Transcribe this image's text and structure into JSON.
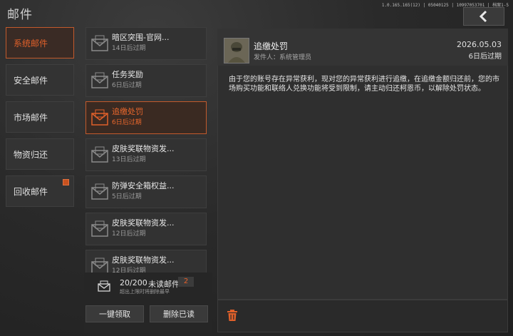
{
  "header": {
    "title": "邮件",
    "version": "1.0.165.165(12) | 05040125 | 10997053701 | 档案1-5"
  },
  "categories": [
    {
      "label": "系统邮件",
      "active": true,
      "badge": false
    },
    {
      "label": "安全邮件",
      "active": false,
      "badge": false
    },
    {
      "label": "市场邮件",
      "active": false,
      "badge": false
    },
    {
      "label": "物资归还",
      "active": false,
      "badge": false
    },
    {
      "label": "回收邮件",
      "active": false,
      "badge": true
    }
  ],
  "mails": [
    {
      "subject": "暗区突围-官网...",
      "expiry": "14日后过期",
      "active": false
    },
    {
      "subject": "任务奖励",
      "expiry": "6日后过期",
      "active": false
    },
    {
      "subject": "追缴处罚",
      "expiry": "6日后过期",
      "active": true
    },
    {
      "subject": "皮肤奖联物资发...",
      "expiry": "13日后过期",
      "active": false
    },
    {
      "subject": "防弹安全箱权益...",
      "expiry": "5日后过期",
      "active": false
    },
    {
      "subject": "皮肤奖联物资发...",
      "expiry": "12日后过期",
      "active": false
    },
    {
      "subject": "皮肤奖联物资发...",
      "expiry": "12日后过期",
      "active": false
    }
  ],
  "list_footer": {
    "count": "20/200",
    "unread_label": "未读邮件",
    "unread_count": "2",
    "hint": "超出上限时将删除最早",
    "claim_all": "一键领取",
    "delete_read": "删除已读"
  },
  "detail": {
    "title": "追缴处罚",
    "sender": "发件人：系统管理员",
    "date": "2026.05.03",
    "expiry": "6日后过期",
    "body": "由于您的账号存在异常获利，现对您的异常获利进行追缴，在追缴金额归还前，您的市场购买功能和联络人兑换功能将受到限制，请主动归还柯恩币，以解除处罚状态。"
  },
  "colors": {
    "accent": "#e0602a",
    "panel": "#323232",
    "background": "#2b2b2b"
  }
}
